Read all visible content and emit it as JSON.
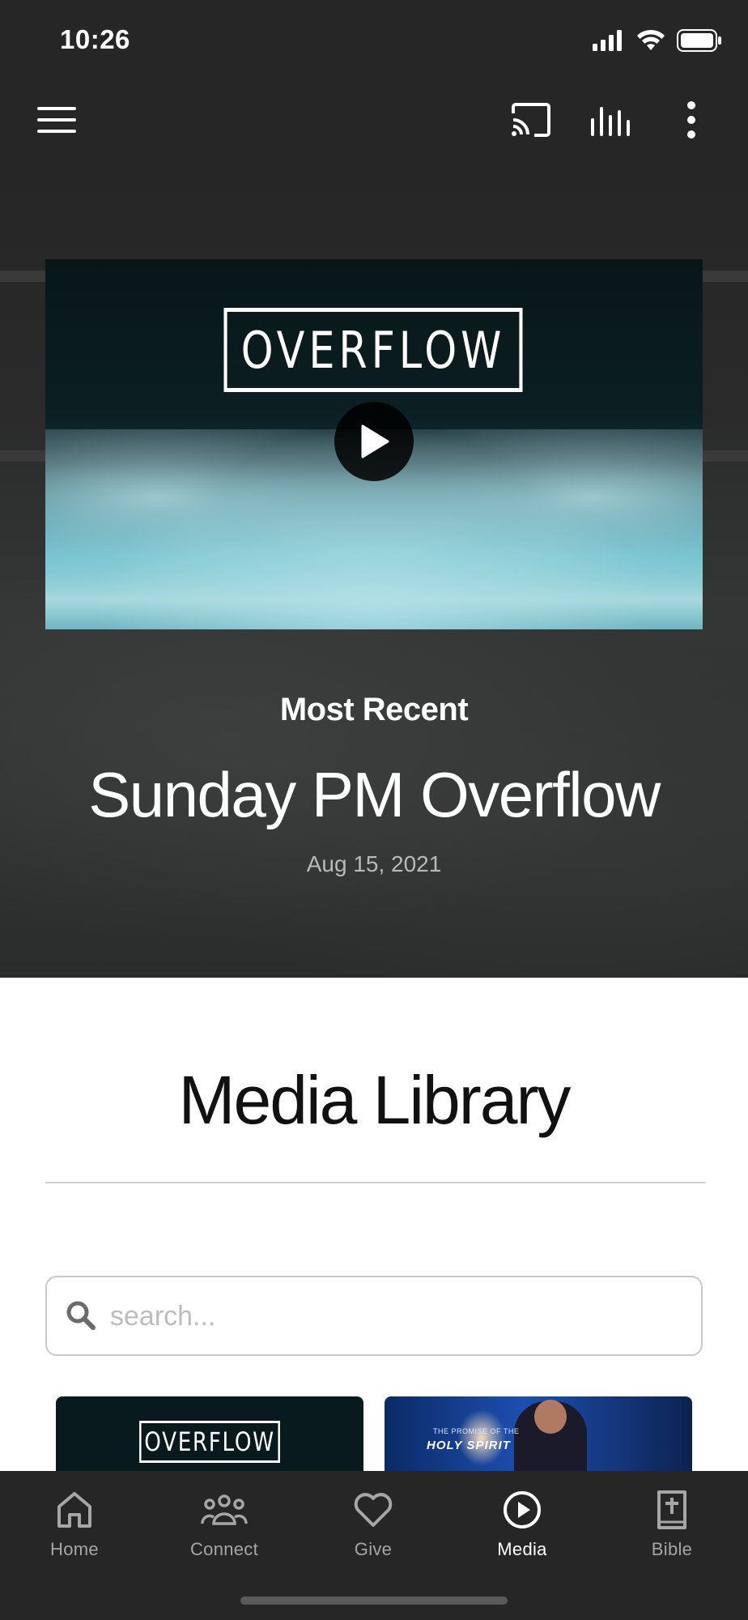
{
  "status_bar": {
    "time": "10:26"
  },
  "app_bar": {
    "icons": [
      "menu-icon",
      "cast-icon",
      "audio-bars-icon",
      "more-vert-icon"
    ]
  },
  "hero": {
    "video_logo_text": "OVERFLOW",
    "section_label": "Most Recent",
    "title": "Sunday PM Overflow",
    "date": "Aug 15, 2021"
  },
  "library": {
    "title": "Media Library",
    "search_placeholder": "search...",
    "items": [
      {
        "thumb_text": "OVERFLOW"
      },
      {
        "thumb_small_text": "THE PROMISE OF THE",
        "thumb_text": "HOLY SPIRIT"
      }
    ]
  },
  "tab_bar": {
    "active": "Media",
    "tabs": [
      {
        "label": "Home",
        "icon": "home-icon"
      },
      {
        "label": "Connect",
        "icon": "people-icon"
      },
      {
        "label": "Give",
        "icon": "heart-icon"
      },
      {
        "label": "Media",
        "icon": "play-circle-icon"
      },
      {
        "label": "Bible",
        "icon": "bible-icon"
      }
    ]
  },
  "colors": {
    "bar_background": "#262626",
    "active_tab": "#ffffff",
    "inactive_tab": "#a6a6a6"
  }
}
